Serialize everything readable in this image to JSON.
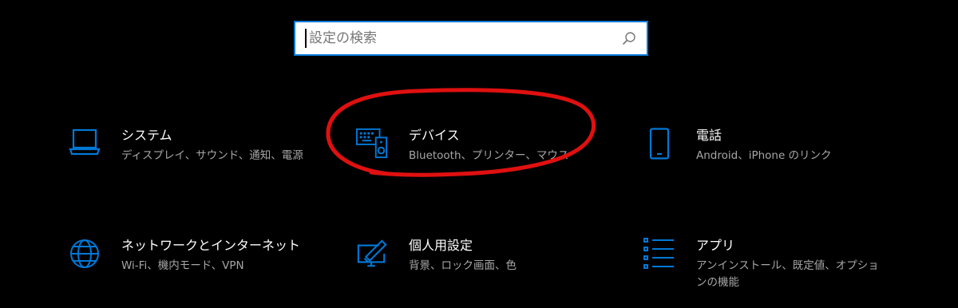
{
  "search": {
    "placeholder": "設定の検索",
    "value": ""
  },
  "tiles": [
    {
      "id": "system",
      "title": "システム",
      "desc": "ディスプレイ、サウンド、通知、電源",
      "icon": "laptop-icon"
    },
    {
      "id": "devices",
      "title": "デバイス",
      "desc": "Bluetooth、プリンター、マウス",
      "icon": "devices-icon"
    },
    {
      "id": "phone",
      "title": "電話",
      "desc": "Android、iPhone のリンク",
      "icon": "phone-icon"
    },
    {
      "id": "network",
      "title": "ネットワークとインターネット",
      "desc": "Wi-Fi、機内モード、VPN",
      "icon": "globe-icon"
    },
    {
      "id": "personalization",
      "title": "個人用設定",
      "desc": "背景、ロック画面、色",
      "icon": "personalization-icon"
    },
    {
      "id": "apps",
      "title": "アプリ",
      "desc": "アンインストール、既定値、オプションの機能",
      "icon": "apps-list-icon"
    }
  ],
  "colors": {
    "accent": "#0078d7",
    "background": "#000000",
    "annotation": "#e01010"
  }
}
